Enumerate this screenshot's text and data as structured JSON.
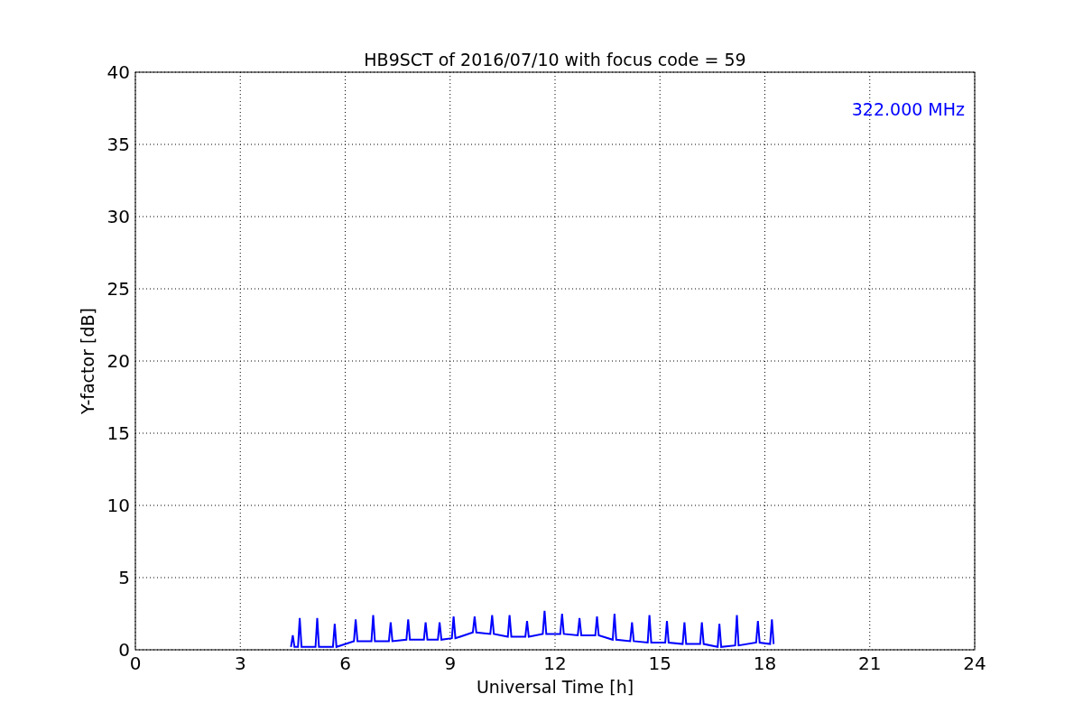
{
  "chart_data": {
    "type": "line",
    "title": "HB9SCT of 2016/07/10 with focus code = 59",
    "xlabel": "Universal Time [h]",
    "ylabel": "Y-factor [dB]",
    "xlim": [
      0,
      24
    ],
    "ylim": [
      0,
      40
    ],
    "xticks": [
      0,
      3,
      6,
      9,
      12,
      15,
      18,
      21,
      24
    ],
    "yticks": [
      0,
      5,
      10,
      15,
      20,
      25,
      30,
      35,
      40
    ],
    "x": [
      4.45,
      4.5,
      4.55,
      4.65,
      4.7,
      4.75,
      5.15,
      5.2,
      5.25,
      5.65,
      5.7,
      5.75,
      6.25,
      6.3,
      6.35,
      6.75,
      6.8,
      6.85,
      7.25,
      7.3,
      7.35,
      7.75,
      7.8,
      7.85,
      8.25,
      8.3,
      8.35,
      8.65,
      8.7,
      8.75,
      9.05,
      9.1,
      9.15,
      9.65,
      9.7,
      9.75,
      10.15,
      10.2,
      10.25,
      10.65,
      10.7,
      10.75,
      11.15,
      11.2,
      11.25,
      11.65,
      11.7,
      11.75,
      12.15,
      12.2,
      12.25,
      12.65,
      12.7,
      12.75,
      13.15,
      13.2,
      13.25,
      13.65,
      13.7,
      13.75,
      14.15,
      14.2,
      14.25,
      14.65,
      14.7,
      14.75,
      15.15,
      15.2,
      15.25,
      15.65,
      15.7,
      15.75,
      16.15,
      16.2,
      16.25,
      16.65,
      16.7,
      16.75,
      17.15,
      17.2,
      17.25,
      17.75,
      17.8,
      17.85,
      18.15,
      18.2,
      18.25
    ],
    "grid": true,
    "series": [
      {
        "name": "322.000 MHz",
        "color": "#0000ff",
        "values": [
          0.2,
          1.0,
          0.2,
          0.2,
          2.2,
          0.2,
          0.2,
          2.2,
          0.2,
          0.2,
          1.8,
          0.2,
          0.6,
          2.1,
          0.6,
          0.6,
          2.4,
          0.6,
          0.6,
          1.9,
          0.6,
          0.7,
          2.1,
          0.7,
          0.7,
          1.9,
          0.7,
          0.7,
          1.9,
          0.7,
          0.8,
          2.3,
          0.8,
          1.2,
          2.3,
          1.2,
          1.1,
          2.4,
          1.1,
          0.9,
          2.4,
          0.9,
          0.9,
          2.0,
          0.9,
          1.1,
          2.7,
          1.1,
          1.1,
          2.5,
          1.1,
          1.0,
          2.2,
          1.0,
          1.0,
          2.3,
          1.0,
          0.7,
          2.5,
          0.7,
          0.6,
          1.9,
          0.6,
          0.5,
          2.4,
          0.5,
          0.5,
          2.0,
          0.5,
          0.4,
          1.9,
          0.4,
          0.4,
          1.9,
          0.4,
          0.2,
          1.8,
          0.2,
          0.3,
          2.4,
          0.3,
          0.5,
          2.0,
          0.5,
          0.4,
          2.1,
          0.4
        ]
      }
    ]
  }
}
